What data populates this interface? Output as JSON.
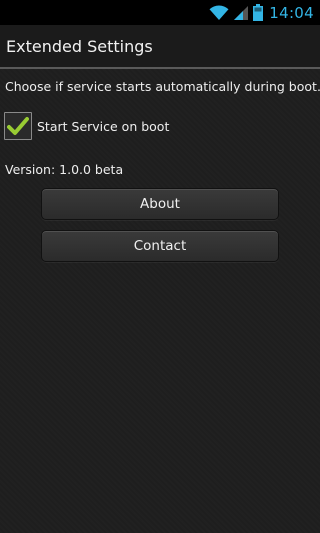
{
  "status_bar": {
    "time": "14:04",
    "icons": [
      "wifi-icon",
      "signal-icon",
      "battery-icon"
    ],
    "accent_color": "#33b5e5"
  },
  "title_bar": {
    "title": "Extended Settings"
  },
  "main": {
    "description": "Choose if service starts automatically during boot.",
    "checkbox": {
      "label": "Start Service on boot",
      "checked": true,
      "check_color": "#99cc33"
    },
    "version": "Version: 1.0.0 beta",
    "buttons": {
      "about_label": "About",
      "contact_label": "Contact"
    }
  }
}
